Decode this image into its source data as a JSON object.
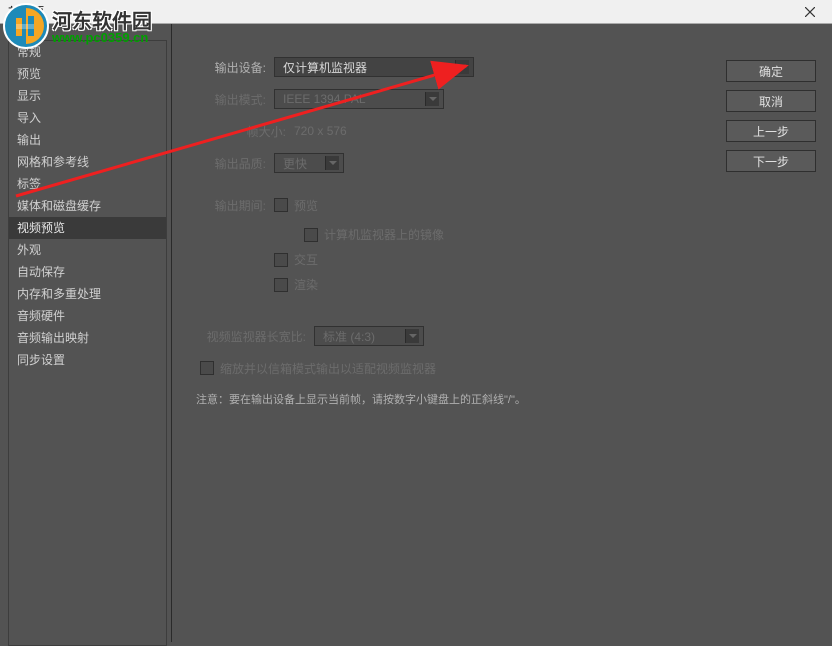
{
  "window": {
    "title": "首选项"
  },
  "watermark": {
    "text": "河东软件园",
    "url": "www.pc0359.cn"
  },
  "sidebar": {
    "items": [
      {
        "label": "常规"
      },
      {
        "label": "预览"
      },
      {
        "label": "显示"
      },
      {
        "label": "导入"
      },
      {
        "label": "输出"
      },
      {
        "label": "网格和参考线"
      },
      {
        "label": "标签"
      },
      {
        "label": "媒体和磁盘缓存"
      },
      {
        "label": "视频预览"
      },
      {
        "label": "外观"
      },
      {
        "label": "自动保存"
      },
      {
        "label": "内存和多重处理"
      },
      {
        "label": "音频硬件"
      },
      {
        "label": "音频输出映射"
      },
      {
        "label": "同步设置"
      }
    ]
  },
  "buttons": {
    "ok": "确定",
    "cancel": "取消",
    "prev": "上一步",
    "next": "下一步"
  },
  "form": {
    "outputDevice": {
      "label": "输出设备:",
      "value": "仅计算机监视器"
    },
    "outputMode": {
      "label": "输出模式:",
      "value": "IEEE 1394 PAL"
    },
    "frameSize": {
      "label": "帧大小:",
      "value": "720 x 576"
    },
    "outputQuality": {
      "label": "输出品质:",
      "value": "更快"
    },
    "outputDuring": {
      "label": "输出期间:"
    },
    "cbPreview": {
      "label": "预览"
    },
    "cbMirror": {
      "label": "计算机监视器上的镜像"
    },
    "cbInteract": {
      "label": "交互"
    },
    "cbRender": {
      "label": "渲染"
    },
    "aspect": {
      "label": "视频监视器长宽比:",
      "value": "标准 (4:3)"
    },
    "letterbox": {
      "label": "缩放并以信箱模式输出以适配视频监视器"
    },
    "note": "注意：要在输出设备上显示当前帧，请按数字小键盘上的正斜线\"/\"。"
  }
}
